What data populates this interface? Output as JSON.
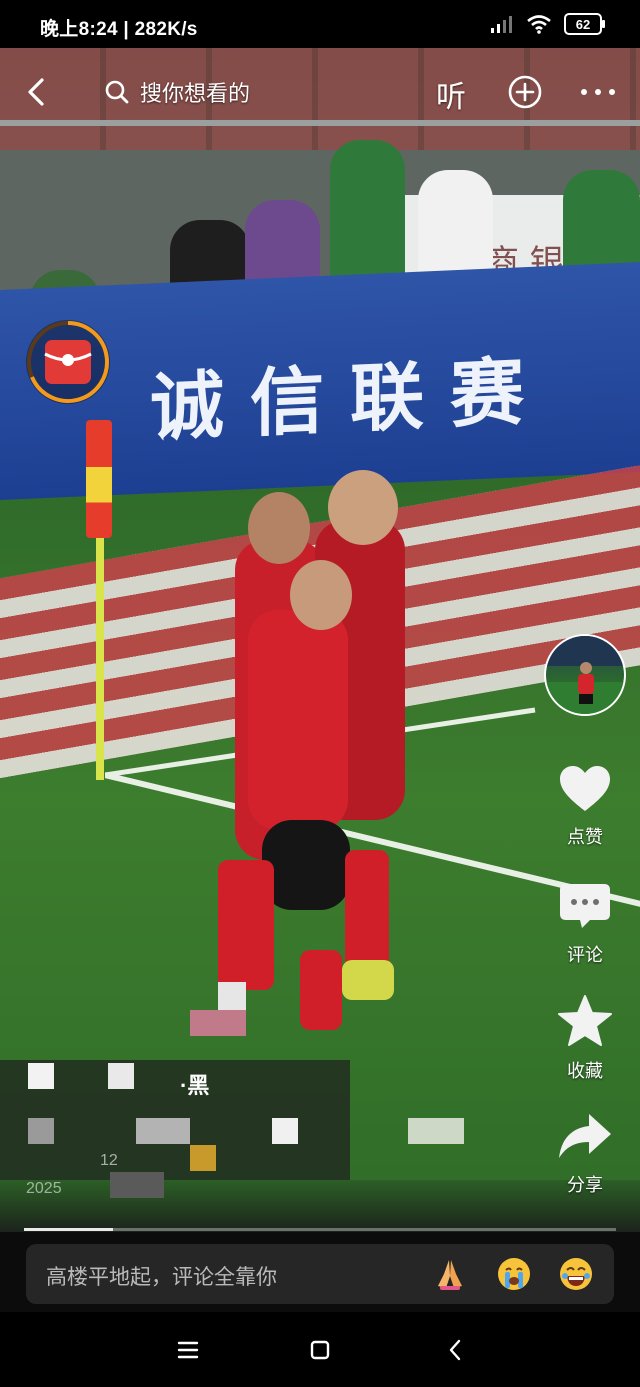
{
  "status_bar": {
    "time_speed": "晚上8:24 | 282K/s",
    "battery": "62"
  },
  "top_nav": {
    "search_placeholder": "搜你想看的",
    "listen_label": "听"
  },
  "video": {
    "banner_text": "诚信联赛",
    "bank_sign_text": "商 银 行"
  },
  "actions": {
    "like_label": "点赞",
    "comment_label": "评论",
    "collect_label": "收藏",
    "share_label": "分享"
  },
  "caption": {
    "author_fragment": "·黑",
    "date_fragment": "2025",
    "location_fragment": "12"
  },
  "progress": {
    "played_fraction": 0.15
  },
  "comment_bar": {
    "placeholder": "高楼平地起，评论全靠你",
    "emojis": [
      "folded-hands",
      "crying-face",
      "laughing-face"
    ]
  },
  "colors": {
    "accent_orange": "#f39a1c",
    "packet_red": "#e23a36",
    "banner_blue": "#1d3f92"
  }
}
